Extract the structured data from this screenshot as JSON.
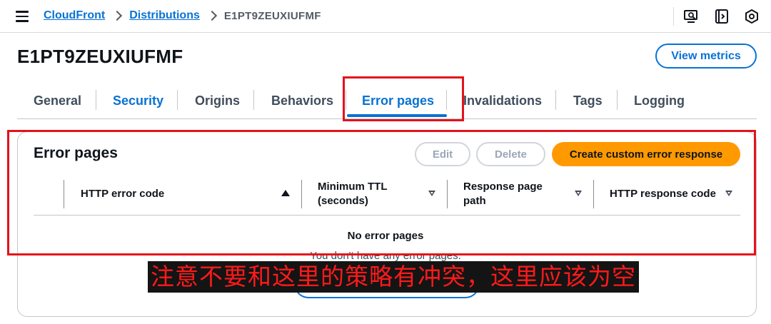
{
  "breadcrumb": {
    "items": [
      "CloudFront",
      "Distributions"
    ],
    "current": "E1PT9ZEUXIUFMF"
  },
  "toolbar_icons": [
    "monitor-search-icon",
    "panel-code-icon",
    "cloudshell-hex-icon"
  ],
  "page": {
    "title": "E1PT9ZEUXIUFMF",
    "view_metrics_label": "View metrics"
  },
  "tabs": [
    {
      "label": "General"
    },
    {
      "label": "Security"
    },
    {
      "label": "Origins"
    },
    {
      "label": "Behaviors"
    },
    {
      "label": "Error pages"
    },
    {
      "label": "Invalidations"
    },
    {
      "label": "Tags"
    },
    {
      "label": "Logging"
    }
  ],
  "active_tab": "Error pages",
  "error_pages": {
    "title": "Error pages",
    "edit_label": "Edit",
    "delete_label": "Delete",
    "create_label": "Create custom error response",
    "columns": [
      {
        "line1": "HTTP error code",
        "line2": "",
        "sort": "ascending"
      },
      {
        "line1": "Minimum TTL",
        "line2": "(seconds)",
        "sort": "none"
      },
      {
        "line1": "Response page",
        "line2": "path",
        "sort": "none"
      },
      {
        "line1": "HTTP response code",
        "line2": "",
        "sort": "none"
      }
    ],
    "empty_title": "No error pages",
    "empty_subtitle": "You don't have any error pages."
  },
  "annotation": {
    "caption": "注意不要和这里的策略有冲突，这里应该为空",
    "color": "#e3131b"
  },
  "colors": {
    "link": "#0972d3",
    "primary_button": "#ff9900"
  }
}
